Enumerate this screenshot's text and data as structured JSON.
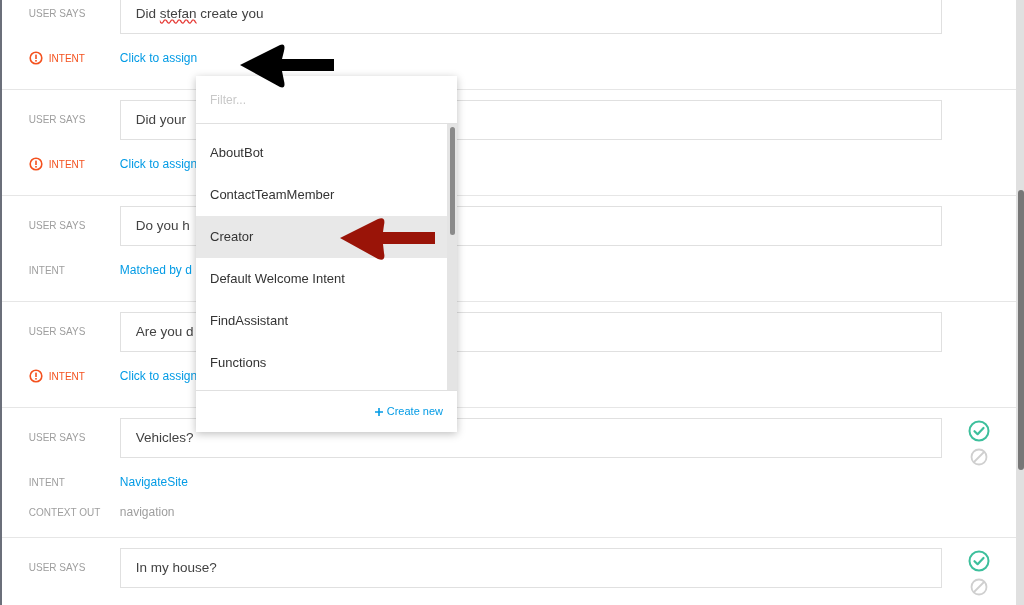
{
  "rows": [
    {
      "user_says_label": "USER SAYS",
      "segments": [
        {
          "text": "Did ",
          "misspelled": false
        },
        {
          "text": "stefan",
          "misspelled": true
        },
        {
          "text": " create you",
          "misspelled": false
        }
      ],
      "intent_label": "INTENT",
      "intent_value": "Click to assign",
      "warning": true,
      "validated": false
    },
    {
      "user_says_label": "USER SAYS",
      "text": "Did your",
      "intent_label": "INTENT",
      "intent_value": "Click to assign",
      "warning": true,
      "validated": false
    },
    {
      "user_says_label": "USER SAYS",
      "text": "Do you h",
      "intent_label": "INTENT",
      "intent_value": "Matched by d",
      "warning": false,
      "validated": false
    },
    {
      "user_says_label": "USER SAYS",
      "text": "Are you d",
      "intent_label": "INTENT",
      "intent_value": "Click to assign",
      "warning": true,
      "validated": false
    },
    {
      "user_says_label": "USER SAYS",
      "text": "Vehicles?",
      "intent_label": "INTENT",
      "intent_value": "NavigateSite",
      "warning": false,
      "context_label": "CONTEXT OUT",
      "context_value": "navigation",
      "validated": true
    },
    {
      "user_says_label": "USER SAYS",
      "text": "In my house?",
      "validated": true
    }
  ],
  "dropdown": {
    "placeholder": "Filter...",
    "items": [
      {
        "label": "AboutBot",
        "selected": false
      },
      {
        "label": "ContactTeamMember",
        "selected": false
      },
      {
        "label": "Creator",
        "selected": true
      },
      {
        "label": "Default Welcome Intent",
        "selected": false
      },
      {
        "label": "FindAssistant",
        "selected": false
      },
      {
        "label": "Functions",
        "selected": false
      }
    ],
    "create_new": "Create new"
  }
}
